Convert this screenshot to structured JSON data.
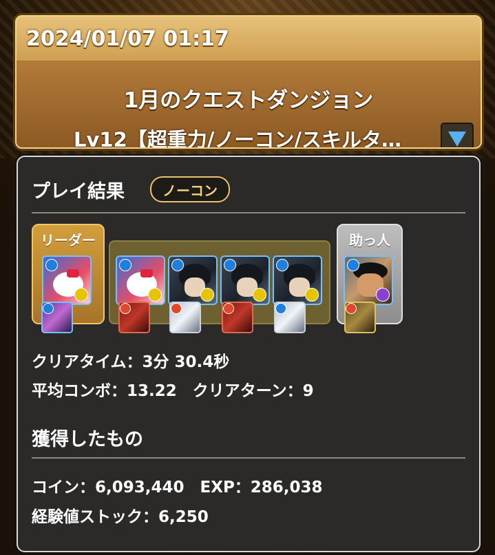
{
  "header": {
    "timestamp": "2024/01/07 01:17",
    "dungeon_name": "1月のクエストダンジョン",
    "dungeon_sub": "Lv12【超重力/ノーコン/スキルタ…",
    "dropdown_icon": "triangle-down-icon"
  },
  "result": {
    "title": "プレイ結果",
    "badge": "ノーコン",
    "leader_label": "リーダー",
    "helper_label": "助っ人",
    "team": [
      {
        "slot": "leader",
        "icon": "hello-kitty-monster-icon",
        "attribute": "water"
      },
      {
        "slot": "sub1",
        "icon": "hello-kitty-monster-icon",
        "attribute": "water"
      },
      {
        "slot": "sub2",
        "icon": "dark-haired-swordsman-icon",
        "attribute": "water"
      },
      {
        "slot": "sub3",
        "icon": "dark-haired-swordsman-icon",
        "attribute": "water"
      },
      {
        "slot": "sub4",
        "icon": "dark-haired-swordsman-icon",
        "attribute": "water"
      },
      {
        "slot": "helper",
        "icon": "muscular-fighter-icon",
        "attribute": "water"
      }
    ],
    "stats": {
      "clear_time": "クリアタイム：3分 30.4秒",
      "combo_turn": "平均コンボ：13.22　クリアターン：9"
    }
  },
  "rewards": {
    "title": "獲得したもの",
    "coin_exp": "コイン：6,093,440　EXP：286,038",
    "exp_stock": "経験値ストック：6,250"
  },
  "colors": {
    "header_gold": "#c49247",
    "panel_bg": "#2b2a28",
    "badge_gold": "#e8c56a",
    "water_blue": "#1e7fe0"
  }
}
